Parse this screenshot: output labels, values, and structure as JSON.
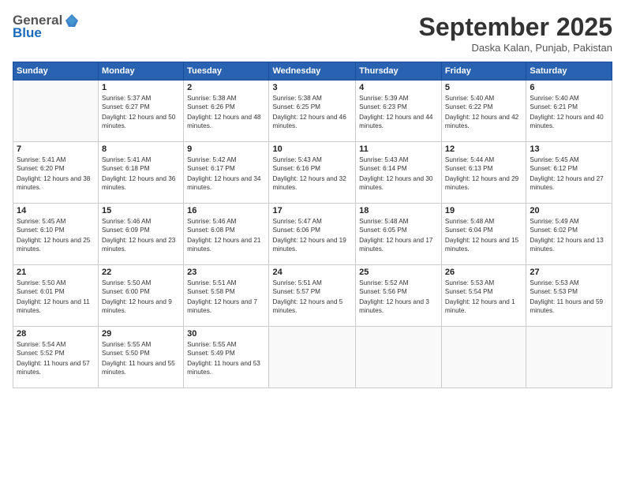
{
  "header": {
    "logo_general": "General",
    "logo_blue": "Blue",
    "month": "September 2025",
    "location": "Daska Kalan, Punjab, Pakistan"
  },
  "days_of_week": [
    "Sunday",
    "Monday",
    "Tuesday",
    "Wednesday",
    "Thursday",
    "Friday",
    "Saturday"
  ],
  "weeks": [
    [
      {
        "num": "",
        "sunrise": "",
        "sunset": "",
        "daylight": ""
      },
      {
        "num": "1",
        "sunrise": "Sunrise: 5:37 AM",
        "sunset": "Sunset: 6:27 PM",
        "daylight": "Daylight: 12 hours and 50 minutes."
      },
      {
        "num": "2",
        "sunrise": "Sunrise: 5:38 AM",
        "sunset": "Sunset: 6:26 PM",
        "daylight": "Daylight: 12 hours and 48 minutes."
      },
      {
        "num": "3",
        "sunrise": "Sunrise: 5:38 AM",
        "sunset": "Sunset: 6:25 PM",
        "daylight": "Daylight: 12 hours and 46 minutes."
      },
      {
        "num": "4",
        "sunrise": "Sunrise: 5:39 AM",
        "sunset": "Sunset: 6:23 PM",
        "daylight": "Daylight: 12 hours and 44 minutes."
      },
      {
        "num": "5",
        "sunrise": "Sunrise: 5:40 AM",
        "sunset": "Sunset: 6:22 PM",
        "daylight": "Daylight: 12 hours and 42 minutes."
      },
      {
        "num": "6",
        "sunrise": "Sunrise: 5:40 AM",
        "sunset": "Sunset: 6:21 PM",
        "daylight": "Daylight: 12 hours and 40 minutes."
      }
    ],
    [
      {
        "num": "7",
        "sunrise": "Sunrise: 5:41 AM",
        "sunset": "Sunset: 6:20 PM",
        "daylight": "Daylight: 12 hours and 38 minutes."
      },
      {
        "num": "8",
        "sunrise": "Sunrise: 5:41 AM",
        "sunset": "Sunset: 6:18 PM",
        "daylight": "Daylight: 12 hours and 36 minutes."
      },
      {
        "num": "9",
        "sunrise": "Sunrise: 5:42 AM",
        "sunset": "Sunset: 6:17 PM",
        "daylight": "Daylight: 12 hours and 34 minutes."
      },
      {
        "num": "10",
        "sunrise": "Sunrise: 5:43 AM",
        "sunset": "Sunset: 6:16 PM",
        "daylight": "Daylight: 12 hours and 32 minutes."
      },
      {
        "num": "11",
        "sunrise": "Sunrise: 5:43 AM",
        "sunset": "Sunset: 6:14 PM",
        "daylight": "Daylight: 12 hours and 30 minutes."
      },
      {
        "num": "12",
        "sunrise": "Sunrise: 5:44 AM",
        "sunset": "Sunset: 6:13 PM",
        "daylight": "Daylight: 12 hours and 29 minutes."
      },
      {
        "num": "13",
        "sunrise": "Sunrise: 5:45 AM",
        "sunset": "Sunset: 6:12 PM",
        "daylight": "Daylight: 12 hours and 27 minutes."
      }
    ],
    [
      {
        "num": "14",
        "sunrise": "Sunrise: 5:45 AM",
        "sunset": "Sunset: 6:10 PM",
        "daylight": "Daylight: 12 hours and 25 minutes."
      },
      {
        "num": "15",
        "sunrise": "Sunrise: 5:46 AM",
        "sunset": "Sunset: 6:09 PM",
        "daylight": "Daylight: 12 hours and 23 minutes."
      },
      {
        "num": "16",
        "sunrise": "Sunrise: 5:46 AM",
        "sunset": "Sunset: 6:08 PM",
        "daylight": "Daylight: 12 hours and 21 minutes."
      },
      {
        "num": "17",
        "sunrise": "Sunrise: 5:47 AM",
        "sunset": "Sunset: 6:06 PM",
        "daylight": "Daylight: 12 hours and 19 minutes."
      },
      {
        "num": "18",
        "sunrise": "Sunrise: 5:48 AM",
        "sunset": "Sunset: 6:05 PM",
        "daylight": "Daylight: 12 hours and 17 minutes."
      },
      {
        "num": "19",
        "sunrise": "Sunrise: 5:48 AM",
        "sunset": "Sunset: 6:04 PM",
        "daylight": "Daylight: 12 hours and 15 minutes."
      },
      {
        "num": "20",
        "sunrise": "Sunrise: 5:49 AM",
        "sunset": "Sunset: 6:02 PM",
        "daylight": "Daylight: 12 hours and 13 minutes."
      }
    ],
    [
      {
        "num": "21",
        "sunrise": "Sunrise: 5:50 AM",
        "sunset": "Sunset: 6:01 PM",
        "daylight": "Daylight: 12 hours and 11 minutes."
      },
      {
        "num": "22",
        "sunrise": "Sunrise: 5:50 AM",
        "sunset": "Sunset: 6:00 PM",
        "daylight": "Daylight: 12 hours and 9 minutes."
      },
      {
        "num": "23",
        "sunrise": "Sunrise: 5:51 AM",
        "sunset": "Sunset: 5:58 PM",
        "daylight": "Daylight: 12 hours and 7 minutes."
      },
      {
        "num": "24",
        "sunrise": "Sunrise: 5:51 AM",
        "sunset": "Sunset: 5:57 PM",
        "daylight": "Daylight: 12 hours and 5 minutes."
      },
      {
        "num": "25",
        "sunrise": "Sunrise: 5:52 AM",
        "sunset": "Sunset: 5:56 PM",
        "daylight": "Daylight: 12 hours and 3 minutes."
      },
      {
        "num": "26",
        "sunrise": "Sunrise: 5:53 AM",
        "sunset": "Sunset: 5:54 PM",
        "daylight": "Daylight: 12 hours and 1 minute."
      },
      {
        "num": "27",
        "sunrise": "Sunrise: 5:53 AM",
        "sunset": "Sunset: 5:53 PM",
        "daylight": "Daylight: 11 hours and 59 minutes."
      }
    ],
    [
      {
        "num": "28",
        "sunrise": "Sunrise: 5:54 AM",
        "sunset": "Sunset: 5:52 PM",
        "daylight": "Daylight: 11 hours and 57 minutes."
      },
      {
        "num": "29",
        "sunrise": "Sunrise: 5:55 AM",
        "sunset": "Sunset: 5:50 PM",
        "daylight": "Daylight: 11 hours and 55 minutes."
      },
      {
        "num": "30",
        "sunrise": "Sunrise: 5:55 AM",
        "sunset": "Sunset: 5:49 PM",
        "daylight": "Daylight: 11 hours and 53 minutes."
      },
      {
        "num": "",
        "sunrise": "",
        "sunset": "",
        "daylight": ""
      },
      {
        "num": "",
        "sunrise": "",
        "sunset": "",
        "daylight": ""
      },
      {
        "num": "",
        "sunrise": "",
        "sunset": "",
        "daylight": ""
      },
      {
        "num": "",
        "sunrise": "",
        "sunset": "",
        "daylight": ""
      }
    ]
  ]
}
